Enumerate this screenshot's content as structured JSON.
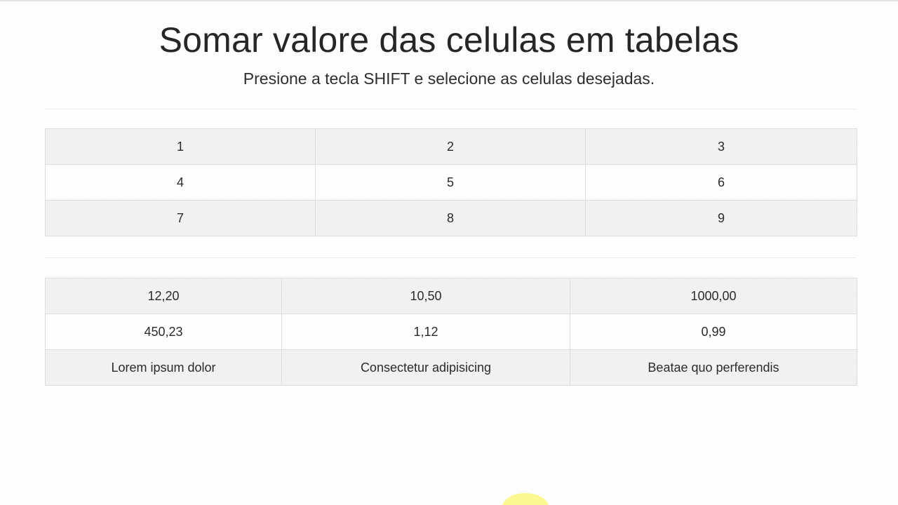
{
  "header": {
    "title": "Somar valore das celulas em tabelas",
    "subtitle": "Presione a tecla SHIFT e selecione as celulas desejadas."
  },
  "table_one": {
    "rows": [
      [
        "1",
        "2",
        "3"
      ],
      [
        "4",
        "5",
        "6"
      ],
      [
        "7",
        "8",
        "9"
      ]
    ]
  },
  "table_two": {
    "rows": [
      [
        "12,20",
        "10,50",
        "1000,00"
      ],
      [
        "450,23",
        "1,12",
        "0,99"
      ],
      [
        "Lorem ipsum dolor",
        "Consectetur adipisicing",
        "Beatae quo perferendis"
      ]
    ]
  },
  "colors": {
    "background": "#fdfdfd",
    "striped_row": "#f3f3f3",
    "border": "#dcdce4",
    "cursor_highlight": "#faf66e"
  }
}
